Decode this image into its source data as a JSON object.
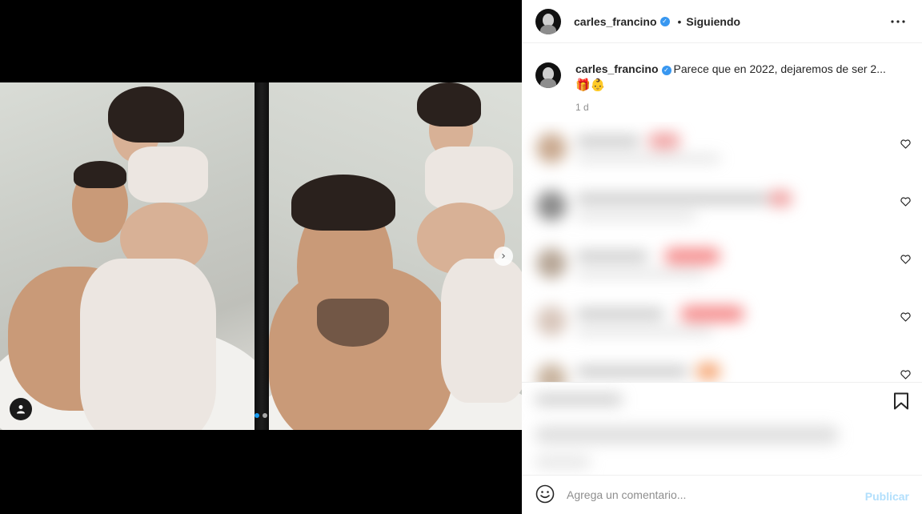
{
  "post": {
    "username": "carles_francino",
    "verified": true,
    "follow_status": "Siguiendo",
    "separator": "•",
    "caption_text": "Parece que en 2022, dejaremos de ser 2...",
    "caption_emojis": "🎁👶",
    "time_ago": "1 d"
  },
  "carousel": {
    "slides_total": 2,
    "active_slide": 1
  },
  "comment_box": {
    "placeholder": "Agrega un comentario...",
    "publish_label": "Publicar"
  },
  "icons": {
    "more": "more-options-icon",
    "verified": "verified-badge-icon",
    "next": "chevron-right-icon",
    "tag": "user-tag-icon",
    "heart": "heart-outline-icon",
    "save": "bookmark-icon",
    "emoji": "emoji-smile-icon"
  },
  "colors": {
    "verified": "#3897f0",
    "active_dot": "#1a9bf0",
    "publish_disabled": "#b2dffc",
    "muted_text": "#8e8e8e"
  }
}
